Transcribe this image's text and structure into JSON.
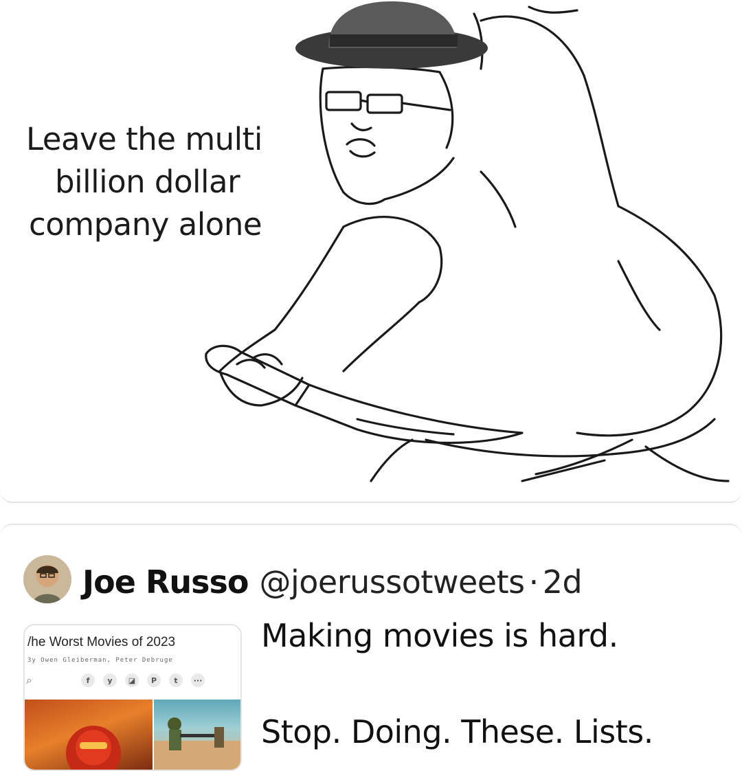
{
  "meme": {
    "caption_lines": [
      "Leave the multi",
      "billion dollar",
      "company alone"
    ]
  },
  "tweet": {
    "author_name": "Joe Russo",
    "author_handle": "@joerussotweets",
    "separator": "·",
    "age": "2d",
    "text_line1": "Making movies is hard.",
    "text_line2": "Stop. Doing. These. Lists.",
    "card": {
      "title": "/he Worst Movies of 2023",
      "byline": "3y Owen Gleiberman, Peter Debruge",
      "share_icons": [
        "f",
        "y",
        "◪",
        "P",
        "t",
        "···"
      ]
    }
  }
}
